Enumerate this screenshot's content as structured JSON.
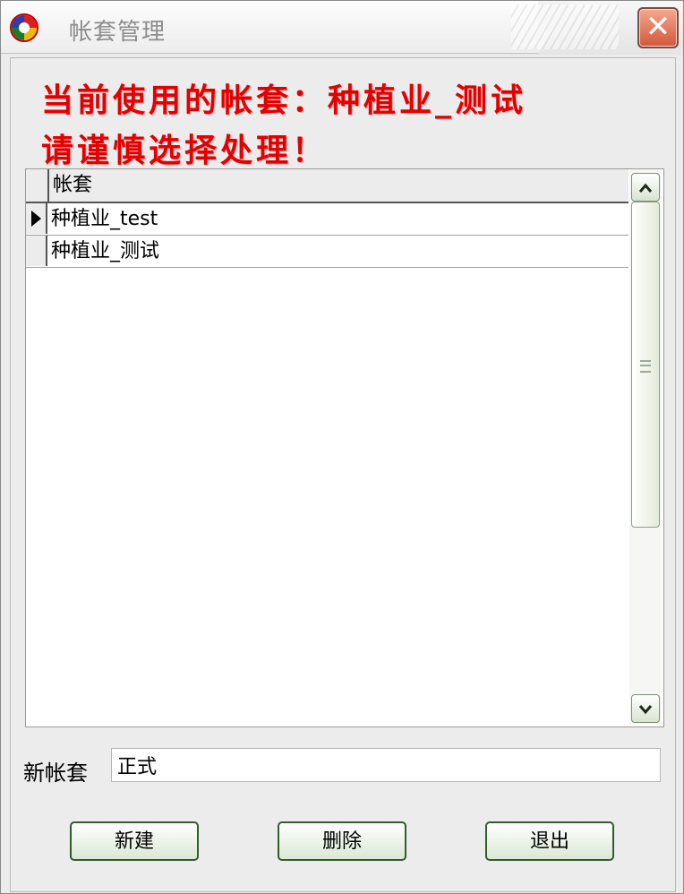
{
  "window": {
    "title": "帐套管理",
    "close_label": "✕"
  },
  "banner": {
    "line1": "当前使用的帐套：种植业_测试",
    "line2": "请谨慎选择处理！"
  },
  "grid": {
    "column_header": "帐套",
    "rows": [
      {
        "name": "种植业_test",
        "selected": true
      },
      {
        "name": "种植业_测试",
        "selected": false
      }
    ]
  },
  "scrollbar": {
    "up_icon": "chevron-up-icon",
    "down_icon": "chevron-down-icon"
  },
  "form": {
    "new_label": "新帐套",
    "new_value": "正式"
  },
  "buttons": {
    "create": "新建",
    "delete": "删除",
    "exit": "退出"
  },
  "colors": {
    "banner_red": "#e20000",
    "close_button": "#d2573b",
    "button_border": "#2f5e2a"
  }
}
